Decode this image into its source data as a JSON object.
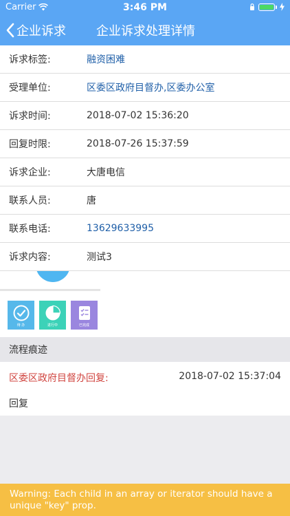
{
  "status_bar": {
    "carrier": "Carrier",
    "time": "3:46 PM"
  },
  "nav": {
    "back_label": "企业诉求",
    "title": "企业诉求处理详情"
  },
  "details": [
    {
      "label": "诉求标签:",
      "value": "融资困难",
      "link": true
    },
    {
      "label": "受理单位:",
      "value": "区委区政府目督办,区委办公室",
      "link": true
    },
    {
      "label": "诉求时间:",
      "value": "2018-07-02 15:36:20",
      "link": false
    },
    {
      "label": "回复时限:",
      "value": "2018-07-26 15:37:59",
      "link": false
    },
    {
      "label": "诉求企业:",
      "value": "大唐电信",
      "link": false
    },
    {
      "label": "联系人员:",
      "value": "唐",
      "link": false
    },
    {
      "label": "联系电话:",
      "value": "13629633995",
      "link": true
    },
    {
      "label": "诉求内容:",
      "value": "测试3",
      "link": false
    }
  ],
  "tiles": [
    {
      "icon": "check-circle-icon",
      "label": "待 办",
      "color": "#56b8ea"
    },
    {
      "icon": "pie-chart-icon",
      "label": "进行中",
      "color": "#3cd2b8"
    },
    {
      "icon": "checklist-icon",
      "label": "已完成",
      "color": "#9a86df"
    }
  ],
  "process": {
    "section_title": "流程痕迹",
    "unit": "区委区政府目督办回复:",
    "time": "2018-07-02 15:37:04",
    "content": "回复"
  },
  "warning": "Warning: Each child in an array or iterator should have a\nunique \"key\" prop.",
  "colors": {
    "header": "#5aa6f4",
    "link": "#1f5fa8",
    "trace_unit": "#d0443f",
    "warning": "#f6bf44"
  }
}
